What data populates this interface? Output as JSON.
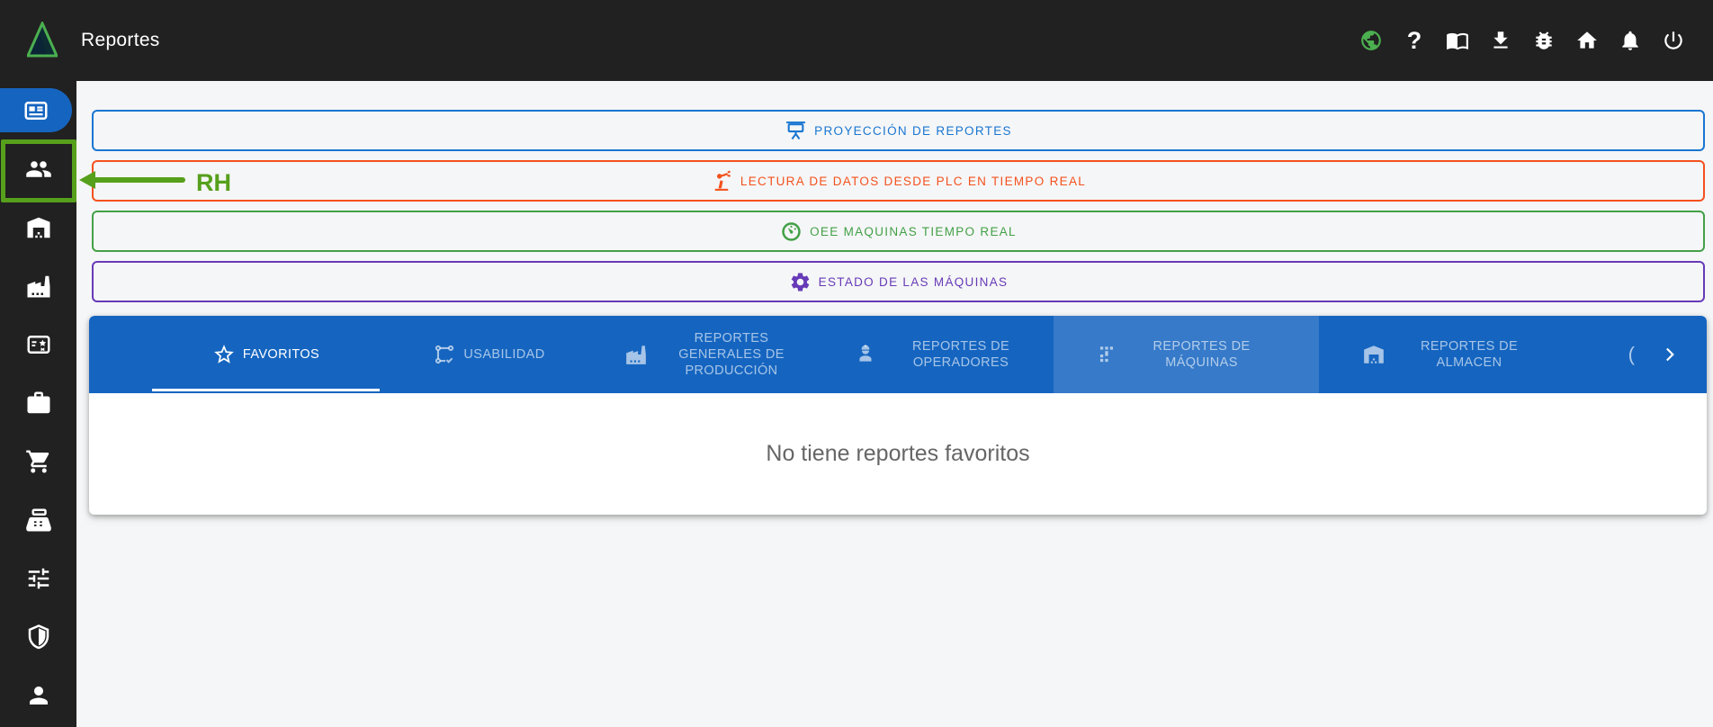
{
  "topbar": {
    "title": "Reportes",
    "help_glyph": "?",
    "icons": [
      "globe-icon",
      "help-icon",
      "manual-book-icon",
      "download-icon",
      "bug-icon",
      "home-icon",
      "bell-icon",
      "power-icon"
    ]
  },
  "sidebar": {
    "items": [
      {
        "icon": "article-icon",
        "active": true
      },
      {
        "icon": "people-icon",
        "highlighted": true
      },
      {
        "icon": "warehouse-icon"
      },
      {
        "icon": "factory-icon"
      },
      {
        "icon": "certificate-icon"
      },
      {
        "icon": "briefcase-icon"
      },
      {
        "icon": "shopping-cart-icon"
      },
      {
        "icon": "cash-register-icon"
      },
      {
        "icon": "tune-icon"
      },
      {
        "icon": "shield-icon"
      },
      {
        "icon": "person-icon"
      }
    ]
  },
  "annotation": {
    "label": "RH",
    "color": "#56a01c"
  },
  "banners": [
    {
      "label": "PROYECCIÓN DE REPORTES",
      "color": "#1976d2",
      "icon": "projector-screen-icon"
    },
    {
      "label": "LECTURA DE DATOS DESDE PLC EN TIEMPO REAL",
      "color": "#f4511e",
      "icon": "robot-arm-icon"
    },
    {
      "label": "OEE MAQUINAS TIEMPO REAL",
      "color": "#43a047",
      "icon": "gauge-icon"
    },
    {
      "label": "ESTADO DE LAS MÁQUINAS",
      "color": "#673ab7",
      "icon": "gear-icon"
    }
  ],
  "tabs": {
    "partial_glyph": "(",
    "items": [
      {
        "label": "FAVORITOS",
        "icon": "star-icon",
        "active": true
      },
      {
        "label": "USABILIDAD",
        "icon": "usability-icon"
      },
      {
        "label": "REPORTES GENERALES DE PRODUCCIÓN",
        "icon": "factory-icon"
      },
      {
        "label": "REPORTES DE OPERADORES",
        "icon": "engineer-icon"
      },
      {
        "label": "REPORTES DE MÁQUINAS",
        "icon": "machine-icon",
        "highlighted": true
      },
      {
        "label": "REPORTES DE ALMACEN",
        "icon": "warehouse-icon"
      }
    ]
  },
  "content": {
    "empty_message": "No tiene reportes favoritos"
  },
  "theme": {
    "topbar_bg": "#212121",
    "sidebar_bg": "#212121",
    "active_blue": "#1565c0",
    "tabbar_blue": "#1565c0",
    "page_bg": "#f5f6f7",
    "card_bg": "#ffffff",
    "muted_text": "#666666",
    "globe_green": "#4caf50"
  }
}
